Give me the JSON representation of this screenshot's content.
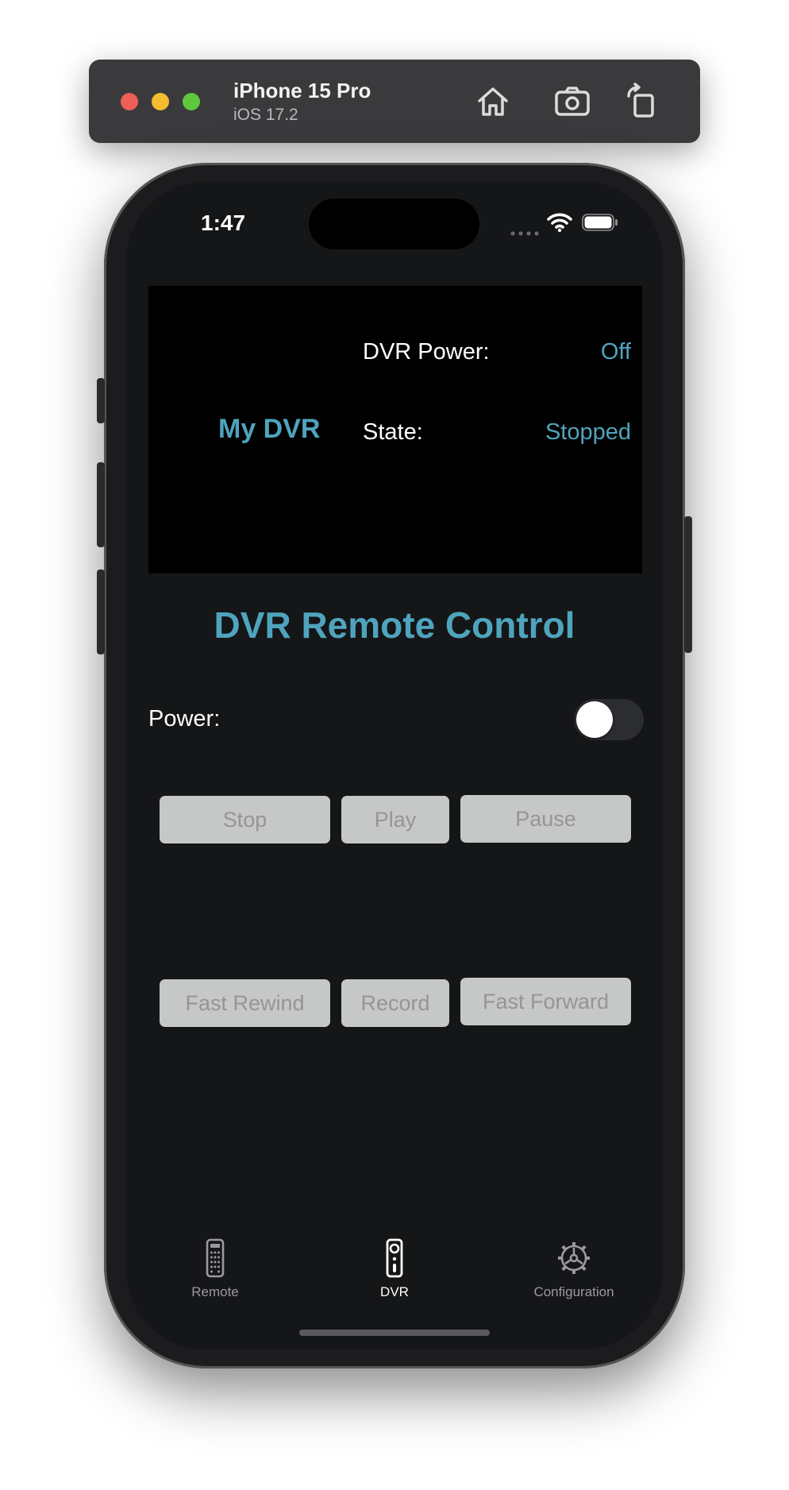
{
  "simulator": {
    "device_name": "iPhone 15 Pro",
    "os_version": "iOS 17.2",
    "buttons": [
      "home-icon",
      "screenshot-icon",
      "rotate-icon"
    ]
  },
  "status_bar": {
    "time": "1:47"
  },
  "info_panel": {
    "device_name": "My DVR",
    "power_label": "DVR Power:",
    "power_value": "Off",
    "state_label": "State:",
    "state_value": "Stopped"
  },
  "main": {
    "title": "DVR Remote Control",
    "power_label": "Power:",
    "power_toggle_on": false
  },
  "controls": {
    "stop": "Stop",
    "play": "Play",
    "pause": "Pause",
    "fast_rewind": "Fast Rewind",
    "record": "Record",
    "fast_forward": "Fast Forward"
  },
  "tab_bar": {
    "tabs": [
      {
        "label": "Remote",
        "icon": "tv-remote-icon",
        "active": false
      },
      {
        "label": "DVR",
        "icon": "dvr-remote-icon",
        "active": true
      },
      {
        "label": "Configuration",
        "icon": "gear-icon",
        "active": false
      }
    ]
  },
  "colors": {
    "accent": "#4fa4bd",
    "background": "#151618",
    "panel": "#000000",
    "disabled_button": "#c6c7c7"
  }
}
